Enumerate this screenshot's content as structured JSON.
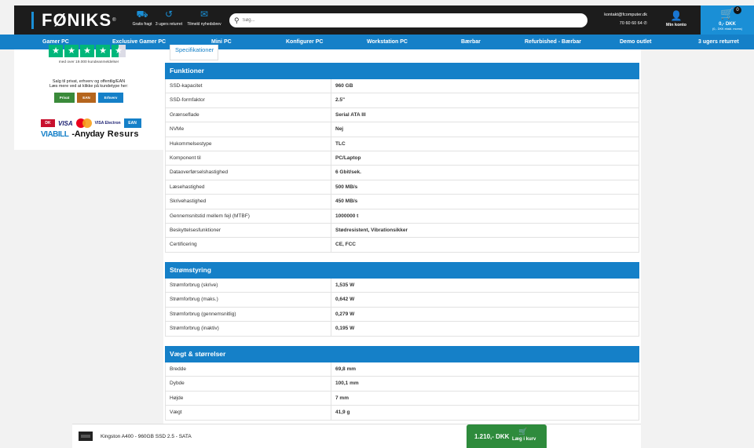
{
  "header": {
    "logo": "FØNIKS",
    "logo_reg": "®",
    "features": [
      {
        "icon": "truck-icon",
        "label": "Gratis fragt"
      },
      {
        "icon": "return-icon",
        "label": "3 ugers returret"
      },
      {
        "icon": "mail-icon",
        "label": "Tilmeld nyhedsbrev"
      }
    ],
    "search_placeholder": "Søg...",
    "contact_email": "kontakt@fcomputer.dk",
    "contact_phone": "70 60 60 64",
    "account_label": "Min konto",
    "cart_count": "0",
    "cart_total": "0,- DKK",
    "cart_note": "(0,- DKK ekskl. moms)"
  },
  "nav": [
    "Gamer PC",
    "Exclusive Gamer PC",
    "Mini PC",
    "Konfigurer PC",
    "Workstation PC",
    "Bærbar",
    "Refurbished - Bærbar",
    "Demo outlet",
    "3 ugers returret"
  ],
  "sidebar": {
    "reviews": "med over 19.000 kundeanmeldelser",
    "sales_line1": "Salg til privat, erhverv og offentlig/EAN",
    "sales_line2": "Læs mere ved at klikke på kundetype her:",
    "btn_privat": "Privat",
    "btn_ean": "EAN",
    "btn_erhverv": "Erhverv",
    "pay": {
      "dk": "DK",
      "visa": "VISA",
      "visa_electron": "VISA Electron",
      "ean": "EAN",
      "viabill": "VIABILL",
      "anyday": "-Anyday",
      "resurs": "Resurs"
    }
  },
  "tab_label": "Specifikationer",
  "sections": [
    {
      "title": "Funktioner",
      "rows": [
        [
          "SSD-kapacitet",
          "960 GB"
        ],
        [
          "SSD-formfaktor",
          "2.5\""
        ],
        [
          "Grænseflade",
          "Serial ATA III"
        ],
        [
          "NVMe",
          "Nej"
        ],
        [
          "Hukommelsestype",
          "TLC"
        ],
        [
          "Komponent til",
          "PC/Laptop"
        ],
        [
          "Dataoverførselshastighed",
          "6 Gbit/sek."
        ],
        [
          "Læsehastighed",
          "500 MB/s"
        ],
        [
          "Skrivehastighed",
          "450 MB/s"
        ],
        [
          "Gennemsnitstid mellem fejl (MTBF)",
          "1000000 t"
        ],
        [
          "Beskyttelsesfunktioner",
          "Stødresistent, Vibrationsikker"
        ],
        [
          "Certificering",
          "CE, FCC"
        ]
      ]
    },
    {
      "title": "Strømstyring",
      "rows": [
        [
          "Strømforbrug (skrive)",
          "1,535 W"
        ],
        [
          "Strømforbrug (maks.)",
          "0,642 W"
        ],
        [
          "Strømforbrug (gennemsnitlig)",
          "0,279 W"
        ],
        [
          "Strømforbrug (inaktiv)",
          "0,195 W"
        ]
      ]
    },
    {
      "title": "Vægt & størrelser",
      "rows": [
        [
          "Bredde",
          "69,8 mm"
        ],
        [
          "Dybde",
          "100,1 mm"
        ],
        [
          "Højde",
          "7 mm"
        ],
        [
          "Vægt",
          "41,9 g"
        ]
      ]
    }
  ],
  "sticky": {
    "product": "Kingston A400 - 960GB SSD 2.5 - SATA",
    "price": "1.210,- DKK",
    "add_label": "Læg i kurv"
  }
}
